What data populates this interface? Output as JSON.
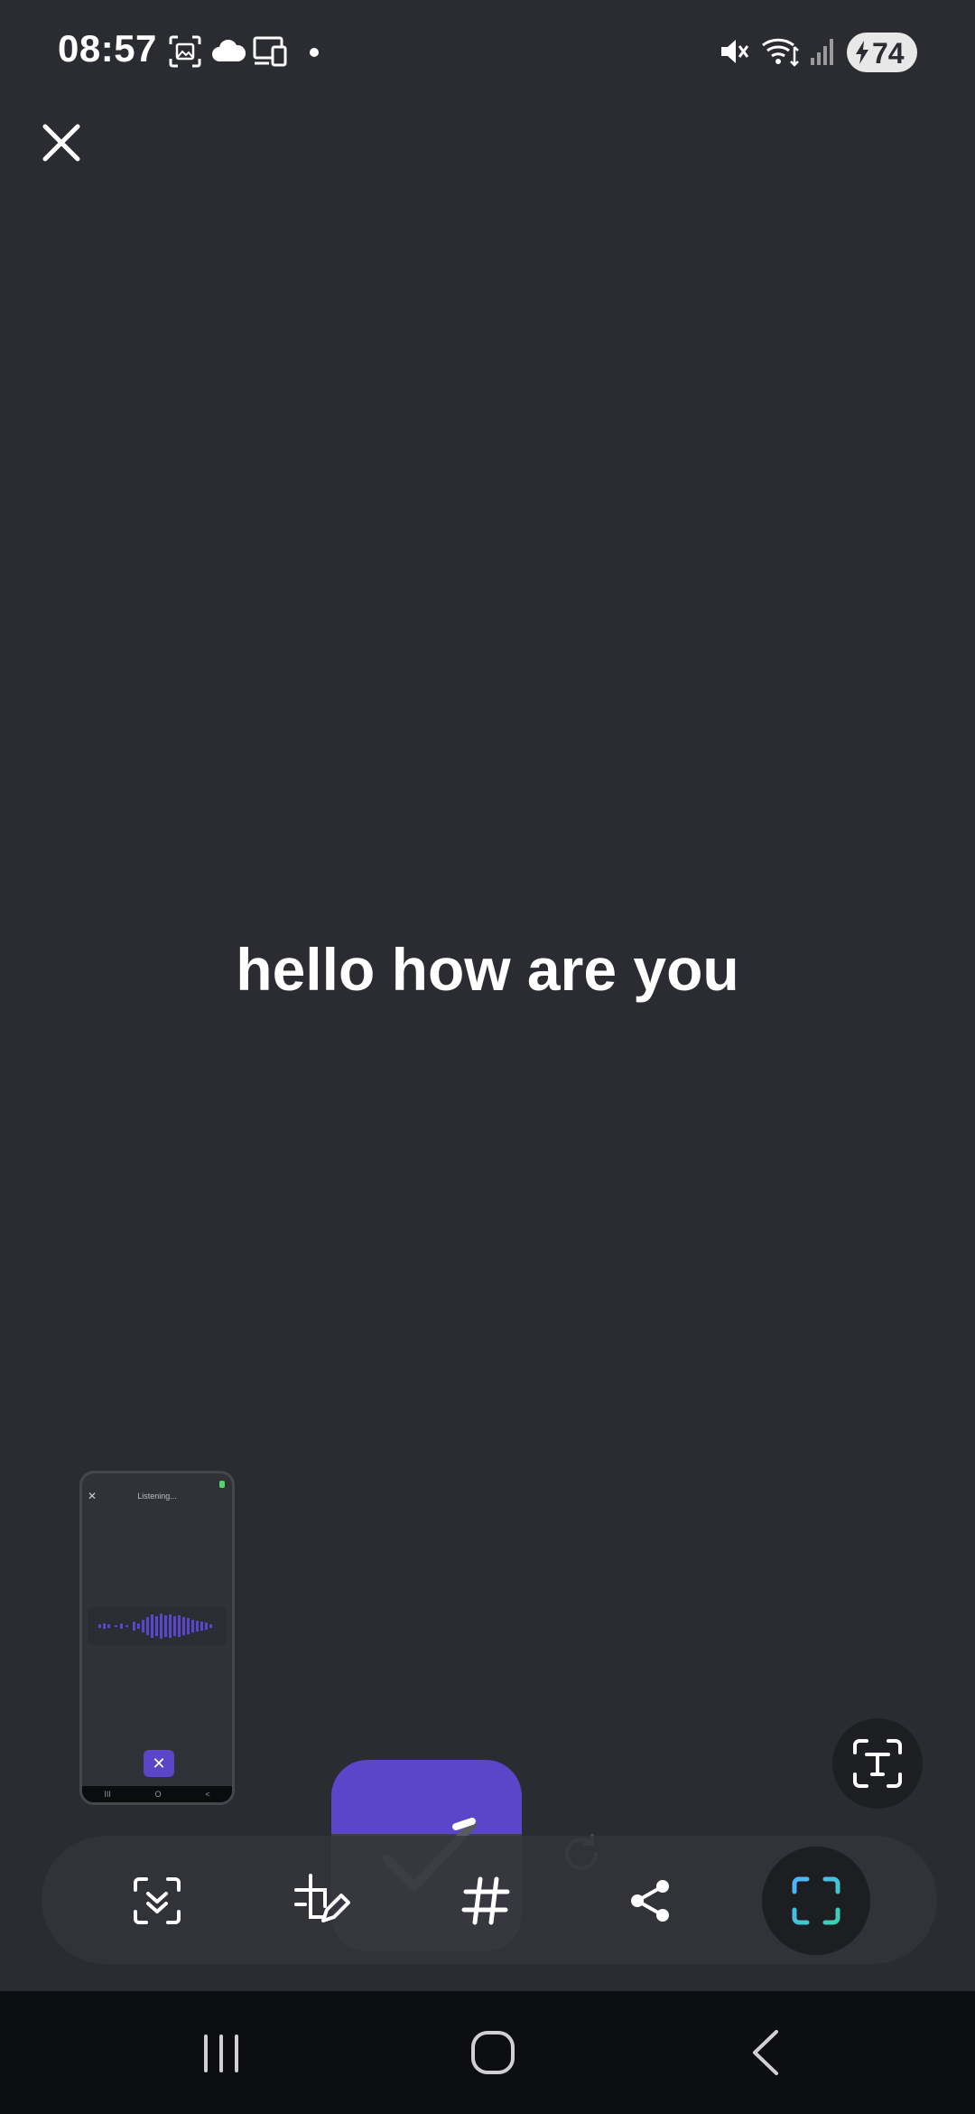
{
  "status_bar": {
    "time": "08:57",
    "battery": "74",
    "icons": [
      "screenshot-icon",
      "cloud-icon",
      "devices-icon",
      "notification-dot-icon",
      "mute-icon",
      "wifi-icon",
      "signal-icon",
      "battery-icon"
    ]
  },
  "header": {
    "close_icon": "close-icon"
  },
  "main": {
    "recognized_text": "hello how are you"
  },
  "thumbnail": {
    "title": "Listening...",
    "close_glyph": "✕",
    "stop_glyph": "✕",
    "nav_glyphs": [
      "III",
      "O",
      "<"
    ]
  },
  "toolbar": {
    "tools": [
      {
        "name": "smart-select-icon"
      },
      {
        "name": "edit-crop-icon"
      },
      {
        "name": "hashtag-icon"
      },
      {
        "name": "share-icon"
      },
      {
        "name": "scan-icon",
        "active": true
      }
    ],
    "text_extract_icon": "text-extract-icon"
  },
  "colors": {
    "background": "#2a2c31",
    "accent": "#5b45c8",
    "scan_gradient_start": "#4fb3ff",
    "scan_gradient_end": "#3ad0b0"
  },
  "nav_bar": {
    "buttons": [
      "recents-icon",
      "home-icon",
      "back-icon"
    ]
  }
}
